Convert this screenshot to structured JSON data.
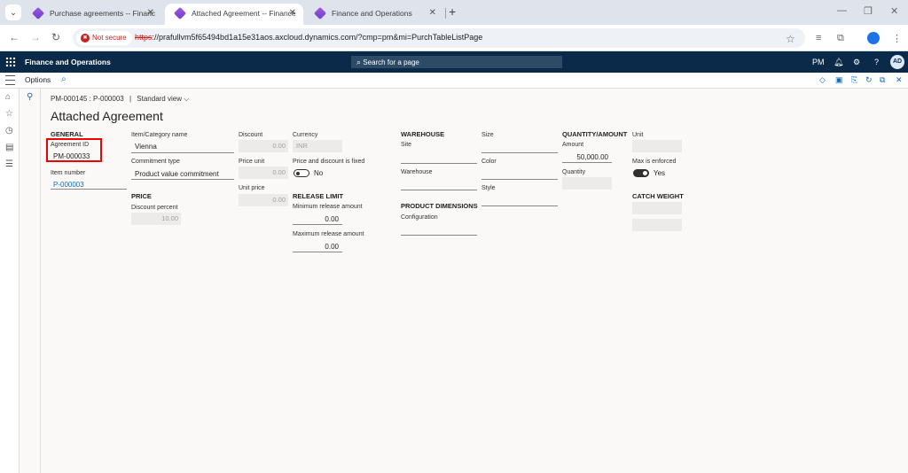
{
  "browser": {
    "tabs": [
      {
        "title": "Purchase agreements -- Financ"
      },
      {
        "title": "Attached Agreement -- Finance"
      },
      {
        "title": "Finance and Operations"
      }
    ],
    "security_label": "Not secure",
    "url_scheme": "https",
    "url_rest": "://prafullvm5f65494bd1a15e31aos.axcloud.dynamics.com/?cmp=pm&mi=PurchTableListPage"
  },
  "app": {
    "name": "Finance and Operations",
    "search_placeholder": "Search for a page",
    "company": "PM",
    "user_initials": "AD"
  },
  "actionpane": {
    "options_label": "Options"
  },
  "breadcrumb": {
    "record": "PM-000145 : P-000003",
    "separator": "|",
    "view": "Standard view"
  },
  "form": {
    "title": "Attached Agreement",
    "general": {
      "header": "GENERAL",
      "agreement_id_label": "Agreement ID",
      "agreement_id": "PM-000033",
      "item_number_label": "Item number",
      "item_number": "P-000003"
    },
    "item": {
      "category_label": "Item/Category name",
      "category": "Vienna",
      "commitment_label": "Commitment type",
      "commitment": "Product value commitment"
    },
    "price": {
      "header": "PRICE",
      "discount_percent_label": "Discount percent",
      "discount_percent": "10.00"
    },
    "pricing": {
      "discount_label": "Discount",
      "discount": "0.00",
      "price_unit_label": "Price unit",
      "price_unit": "0.00",
      "unit_price_label": "Unit price",
      "unit_price": "0.00"
    },
    "currency": {
      "label": "Currency",
      "value": "INR",
      "fixed_label": "Price and discount is fixed",
      "fixed_value": "No"
    },
    "release_limit": {
      "header": "RELEASE LIMIT",
      "min_label": "Minimum release amount",
      "min": "0.00",
      "max_label": "Maximum release amount",
      "max": "0.00"
    },
    "warehouse": {
      "header": "WAREHOUSE",
      "site_label": "Site",
      "warehouse_label": "Warehouse"
    },
    "product_dimensions": {
      "header": "PRODUCT DIMENSIONS",
      "configuration_label": "Configuration"
    },
    "dims": {
      "size_label": "Size",
      "color_label": "Color",
      "style_label": "Style"
    },
    "quantity_amount": {
      "header": "QUANTITY/AMOUNT",
      "amount_label": "Amount",
      "amount": "50,000.00",
      "quantity_label": "Quantity"
    },
    "unit_col": {
      "unit_label": "Unit",
      "max_enforced_label": "Max is enforced",
      "max_enforced_value": "Yes",
      "catch_weight_header": "CATCH WEIGHT"
    }
  }
}
